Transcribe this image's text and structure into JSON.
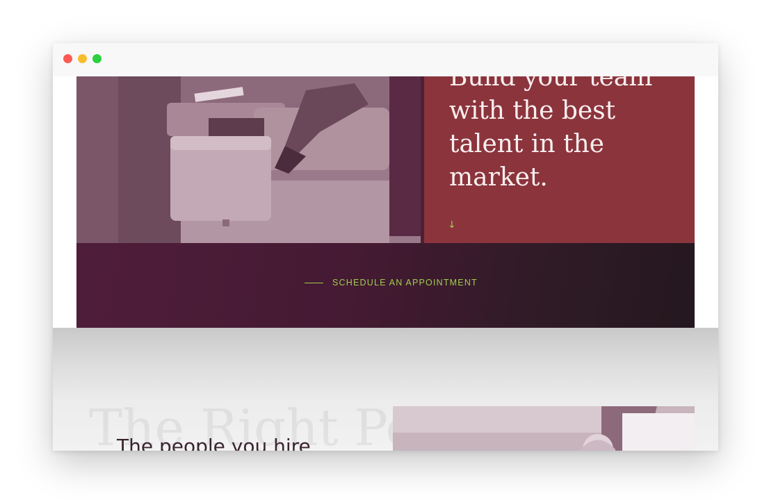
{
  "window": {
    "controls": [
      "close",
      "minimize",
      "maximize"
    ]
  },
  "hero": {
    "heading": "Build your team\nwith the best\ntalent in the\nmarket.",
    "scroll_icon": "arrow-down-icon",
    "scroll_glyph": "↓"
  },
  "cta": {
    "label": "SCHEDULE AN APPOINTMENT"
  },
  "section": {
    "background_title": "The Right Pe",
    "heading": "The people you hire"
  },
  "colors": {
    "hero_panel": "#8b343c",
    "cta_band": "#4f1d3a",
    "accent_green": "#9fce4e",
    "photo_tint": "#7e5a6d"
  }
}
